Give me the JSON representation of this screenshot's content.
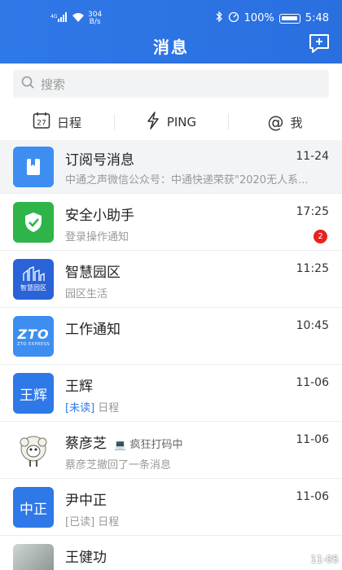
{
  "status_bar": {
    "signal": "4G",
    "net_speed_value": "304",
    "net_speed_unit": "B/s",
    "battery": "100%",
    "time": "5:48"
  },
  "header": {
    "title": "消息"
  },
  "search": {
    "placeholder": "搜索"
  },
  "quick_tabs": [
    {
      "icon": "calendar-icon",
      "calendar_day": "27",
      "label": "日程"
    },
    {
      "icon": "lightning-icon",
      "label": "PING"
    },
    {
      "icon": "at-icon",
      "label": "我"
    }
  ],
  "messages": [
    {
      "name": "订阅号消息",
      "time": "11-24",
      "preview": "中通之声微信公众号：中通快递荣获\"2020无人系...",
      "avatar": "bookmark-icon",
      "color": "#3d8ef0"
    },
    {
      "name": "安全小助手",
      "time": "17:25",
      "preview": "登录操作通知",
      "avatar": "shield-check-icon",
      "color": "#2fb44a",
      "badge": "2"
    },
    {
      "name": "智慧园区",
      "time": "11:25",
      "preview": "园区生活",
      "avatar": "smart-park-logo",
      "avatar_text": "智慧园区",
      "color": "#2a63d8"
    },
    {
      "name": "工作通知",
      "time": "10:45",
      "preview": "",
      "avatar": "zto-logo",
      "avatar_text": "ZTO",
      "avatar_subtext": "ZTO EXPRESS",
      "color": "#3d8ef0"
    },
    {
      "name": "王辉",
      "time": "11-06",
      "preview_tag": "[未读]",
      "preview": "日程",
      "avatar_text": "王辉",
      "color": "#2f78e8"
    },
    {
      "name": "蔡彦芝",
      "status": "疯狂打码中",
      "time": "11-06",
      "preview": "蔡彦芝撤回了一条消息",
      "avatar": "sheep-avatar"
    },
    {
      "name": "尹中正",
      "time": "11-06",
      "preview_tag": "[已读]",
      "preview": "日程",
      "avatar_text": "中正",
      "color": "#2f78e8"
    },
    {
      "name": "王健功",
      "time": "",
      "preview": "",
      "avatar": "photo-avatar"
    }
  ],
  "watermark": "11-05"
}
